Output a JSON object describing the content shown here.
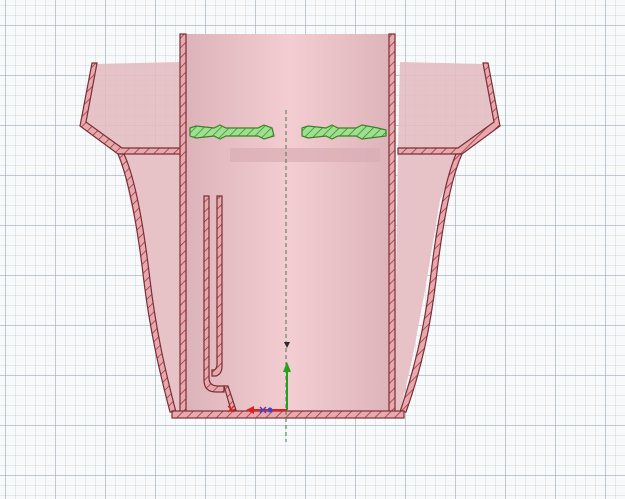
{
  "app": {
    "view": "section-view",
    "visible_text": []
  },
  "colors": {
    "body_fill": "#f1c7cc",
    "body_shade": "#dca3aa",
    "section_fill": "#e8a9ae",
    "section_stroke": "#7a2e35",
    "hatch": "#9a3a40",
    "selection_fill": "#9de08e",
    "selection_stroke": "#3d7f2b",
    "axis_x": "#e02020",
    "axis_y": "#1ca51c",
    "origin_blue": "#3b48c8",
    "grid_major": "#96a5b4",
    "grid_minor": "#bec8d2"
  },
  "icons": {
    "origin": "origin-triad-icon",
    "x_axis": "x-axis-arrow-icon",
    "y_axis": "y-axis-arrow-icon"
  }
}
